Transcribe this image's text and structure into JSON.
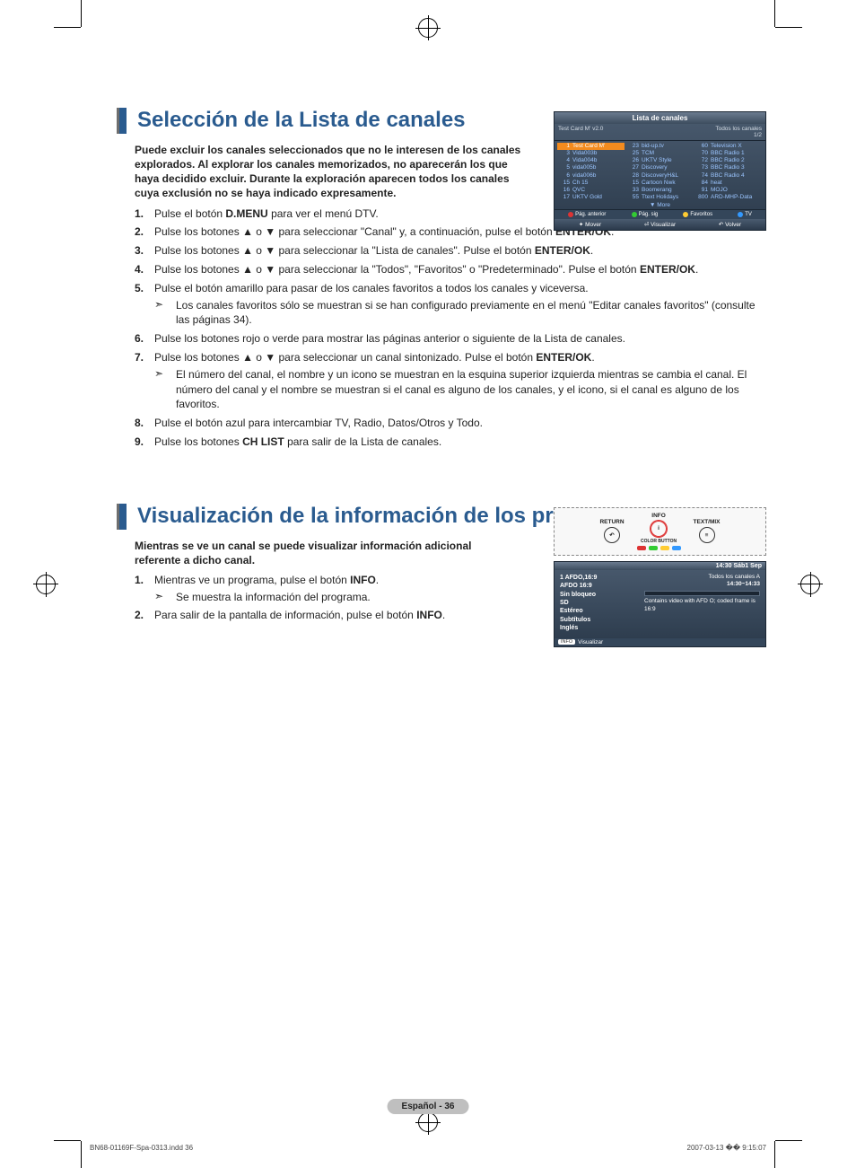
{
  "section1": {
    "heading": "Selección de la Lista de canales",
    "intro": "Puede excluir los canales seleccionados que no le interesen de los canales explorados. Al explorar los canales memorizados, no aparecerán los que haya decidido excluir. Durante la exploración aparecen todos los canales cuya exclusión no se haya indicado expresamente.",
    "steps": [
      {
        "n": "1.",
        "t": "Pulse el botón <b>D.MENU</b> para ver el menú DTV."
      },
      {
        "n": "2.",
        "t": "Pulse los botones ▲ o ▼ para seleccionar \"Canal\" y, a continuación, pulse el botón <b>ENTER/OK</b>."
      },
      {
        "n": "3.",
        "t": "Pulse los botones ▲ o ▼ para seleccionar la \"Lista de canales\". Pulse el botón <b>ENTER/OK</b>."
      },
      {
        "n": "4.",
        "t": "Pulse los botones ▲ o ▼ para seleccionar la \"Todos\", \"Favoritos\" o \"Predeterminado\". Pulse el botón <b>ENTER/OK</b>."
      },
      {
        "n": "5.",
        "t": "Pulse el botón amarillo para pasar de los canales favoritos a todos los canales y viceversa.",
        "sub": "Los canales favoritos sólo se muestran si se han configurado previamente en el menú \"Editar canales favoritos\" (consulte las páginas 34)."
      },
      {
        "n": "6.",
        "t": "Pulse los botones rojo o verde para mostrar las páginas anterior o siguiente de la Lista de canales."
      },
      {
        "n": "7.",
        "t": "Pulse los botones ▲ o ▼ para seleccionar un canal sintonizado. Pulse el botón <b>ENTER/OK</b>.",
        "sub": "El número del canal, el nombre y un icono se muestran en la esquina superior izquierda mientras se cambia el canal. El número del canal y el nombre se muestran si el canal es alguno de los canales, y el icono, si el canal es alguno de los favoritos."
      },
      {
        "n": "8.",
        "t": "Pulse el botón azul para intercambiar TV, Radio, Datos/Otros y Todo."
      },
      {
        "n": "9.",
        "t": "Pulse los botones <b>CH LIST</b> para salir de la Lista de canales."
      }
    ]
  },
  "osd": {
    "title": "Lista de canales",
    "sub_left": "Test Card M' v2.0",
    "sub_right": "Todos los canales",
    "page": "1/2",
    "cols": [
      [
        {
          "n": "1",
          "t": "Test Card M'",
          "hl": true
        },
        {
          "n": "3",
          "t": "Vida003b"
        },
        {
          "n": "4",
          "t": "Vida004b"
        },
        {
          "n": "5",
          "t": "vida005b"
        },
        {
          "n": "6",
          "t": "vida006b"
        },
        {
          "n": "15",
          "t": "Ch 15"
        },
        {
          "n": "16",
          "t": "QVC"
        },
        {
          "n": "17",
          "t": "UKTV Gold"
        }
      ],
      [
        {
          "n": "23",
          "t": "bid-up.tv"
        },
        {
          "n": "25",
          "t": "TCM"
        },
        {
          "n": "26",
          "t": "UKTV Style"
        },
        {
          "n": "27",
          "t": "Discovery"
        },
        {
          "n": "28",
          "t": "DiscoveryH&L"
        },
        {
          "n": "15",
          "t": "Cartoon Nwk"
        },
        {
          "n": "33",
          "t": "Boomerang"
        },
        {
          "n": "55",
          "t": "Ttext Holidays"
        }
      ],
      [
        {
          "n": "60",
          "t": "Television X"
        },
        {
          "n": "70",
          "t": "BBC Radio 1"
        },
        {
          "n": "72",
          "t": "BBC Radio 2"
        },
        {
          "n": "73",
          "t": "BBC Radio 3"
        },
        {
          "n": "74",
          "t": "BBC Radio 4"
        },
        {
          "n": "84",
          "t": "heat"
        },
        {
          "n": "91",
          "t": "MOJO"
        },
        {
          "n": "800",
          "t": "ARD-MHP-Data"
        }
      ]
    ],
    "more": "▼ More",
    "btns": {
      "red": "Pág. anterior",
      "green": "Pág. sig",
      "yellow": "Favoritos",
      "blue": "TV"
    },
    "nav": {
      "move": "Mover",
      "view": "Visualizar",
      "ret": "Volver"
    }
  },
  "section2": {
    "heading": "Visualización de la información de los programas",
    "intro": "Mientras se ve un canal se puede visualizar información adicional referente a dicho canal.",
    "steps": [
      {
        "n": "1.",
        "t": "Mientras ve un programa, pulse el botón <b>INFO</b>.",
        "sub": "Se muestra la información del programa."
      },
      {
        "n": "2.",
        "t": "Para salir de la pantalla de información, pulse el botón <b>INFO</b>."
      }
    ]
  },
  "remote": {
    "return": "RETURN",
    "info": "INFO",
    "text": "TEXT/MIX",
    "color": "COLOR BUTTON"
  },
  "info_osd": {
    "time_header": "14:30 Sáb1 Sep",
    "left_lines": [
      "1 AFDO,16:9",
      "AFDO 16:9",
      "Sin bloqueo",
      "SD",
      "Estéreo",
      "Subtítulos",
      "Inglés"
    ],
    "right_top": "Todos los canales   A",
    "right_time": "14:30~14:33",
    "desc": "Contains video with AFD O; coded frame is 16:9",
    "foot_label": "INFO",
    "foot_text": "Visualizar"
  },
  "page_number": "Español - 36",
  "footer_left": "BN68-01169F-Spa-0313.indd   36",
  "footer_right": "2007-03-13   �� 9:15:07"
}
